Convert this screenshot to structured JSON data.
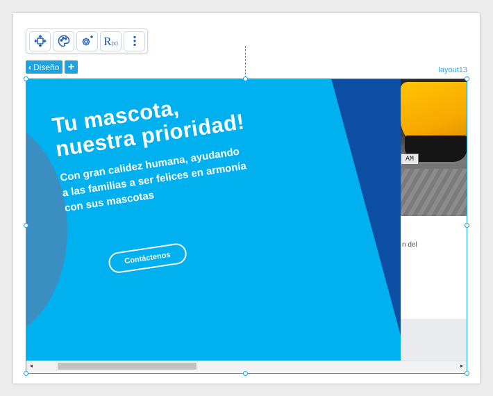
{
  "toolbar": {
    "items": [
      {
        "icon": "move-icon"
      },
      {
        "icon": "palette-icon"
      },
      {
        "icon": "settings-gear-icon"
      },
      {
        "icon": "r-function-icon",
        "label": "R",
        "sub": "(x)"
      },
      {
        "icon": "more-vertical-icon"
      }
    ]
  },
  "design_tab": {
    "label": "Diseño"
  },
  "add_tab": {
    "label": "+"
  },
  "layout_label": "layout13",
  "hero": {
    "title": "Tu mascota,\nnuestra prioridad!",
    "subtitle": "Con gran calidez humana, ayudando\na las familias a ser felices en armonía\ncon sus mascotas",
    "cta": "Contáctenos",
    "colors": {
      "background": "#00b0ef",
      "accent_dark": "#0b4ea3",
      "circle": "#3a8ec2"
    }
  },
  "side_card": {
    "plate_text": "AM",
    "snippet": "n del"
  },
  "scrollbar": {
    "left_arrow": "◂",
    "right_arrow": "▸"
  },
  "colors": {
    "selection": "#1fa2e0",
    "icon_blue": "#1d5fb0"
  }
}
